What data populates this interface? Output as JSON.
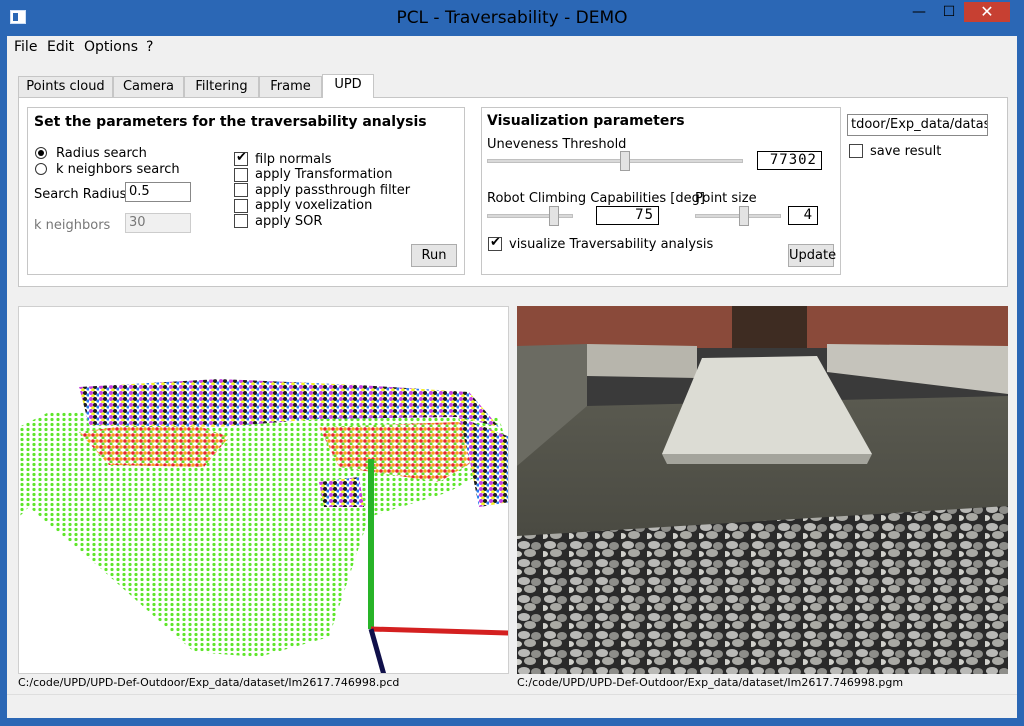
{
  "window": {
    "title": "PCL - Traversability - DEMO",
    "min_symbol": "—",
    "max_symbol": "☐",
    "close_symbol": "✕"
  },
  "menu": {
    "items": [
      "File",
      "Edit",
      "Options",
      "?"
    ]
  },
  "tabs": {
    "items": [
      "Points cloud",
      "Camera",
      "Filtering",
      "Frame",
      "UPD"
    ],
    "active": "UPD"
  },
  "params_group": {
    "title": "Set the parameters for the traversability analysis",
    "radius_search_label": "Radius search",
    "radius_search_selected": true,
    "k_neighbors_search_label": "k neighbors search",
    "search_radius_label": "Search Radius",
    "search_radius_value": "0.5",
    "k_neighbors_label": "k neighbors",
    "k_neighbors_value": "30",
    "checkboxes": [
      {
        "label": "filp normals",
        "checked": true
      },
      {
        "label": "apply Transformation",
        "checked": false
      },
      {
        "label": "apply passthrough filter",
        "checked": false
      },
      {
        "label": "apply voxelization",
        "checked": false
      },
      {
        "label": "apply SOR",
        "checked": false
      }
    ],
    "run_button": "Run"
  },
  "vis_group": {
    "title": "Visualization parameters",
    "uneveness_label": "Uneveness Threshold",
    "uneveness_value": "77302",
    "climbing_label": "Robot Climbing Capabilities [deg]",
    "climbing_value": "75",
    "point_size_label": "Point size",
    "point_size_value": "4",
    "visualize_label": "visualize Traversability analysis",
    "visualize_checked": true,
    "update_button": "Update"
  },
  "right_panel": {
    "dataset_path": "tdoor/Exp_data/dataset",
    "save_result_label": "save result",
    "save_result_checked": false
  },
  "views": {
    "left_path": "C:/code/UPD/UPD-Def-Outdoor/Exp_data/dataset/Im2617.746998.pcd",
    "right_path": "C:/code/UPD/UPD-Def-Outdoor/Exp_data/dataset/Im2617.746998.pgm"
  },
  "colors": {
    "titlebar": "#2b67b5",
    "close_button": "#c74032",
    "traversable_green": "#5ee62a",
    "axis_x_red": "#d42020",
    "axis_y_green": "#28b428",
    "axis_z_navy": "#10104a"
  }
}
